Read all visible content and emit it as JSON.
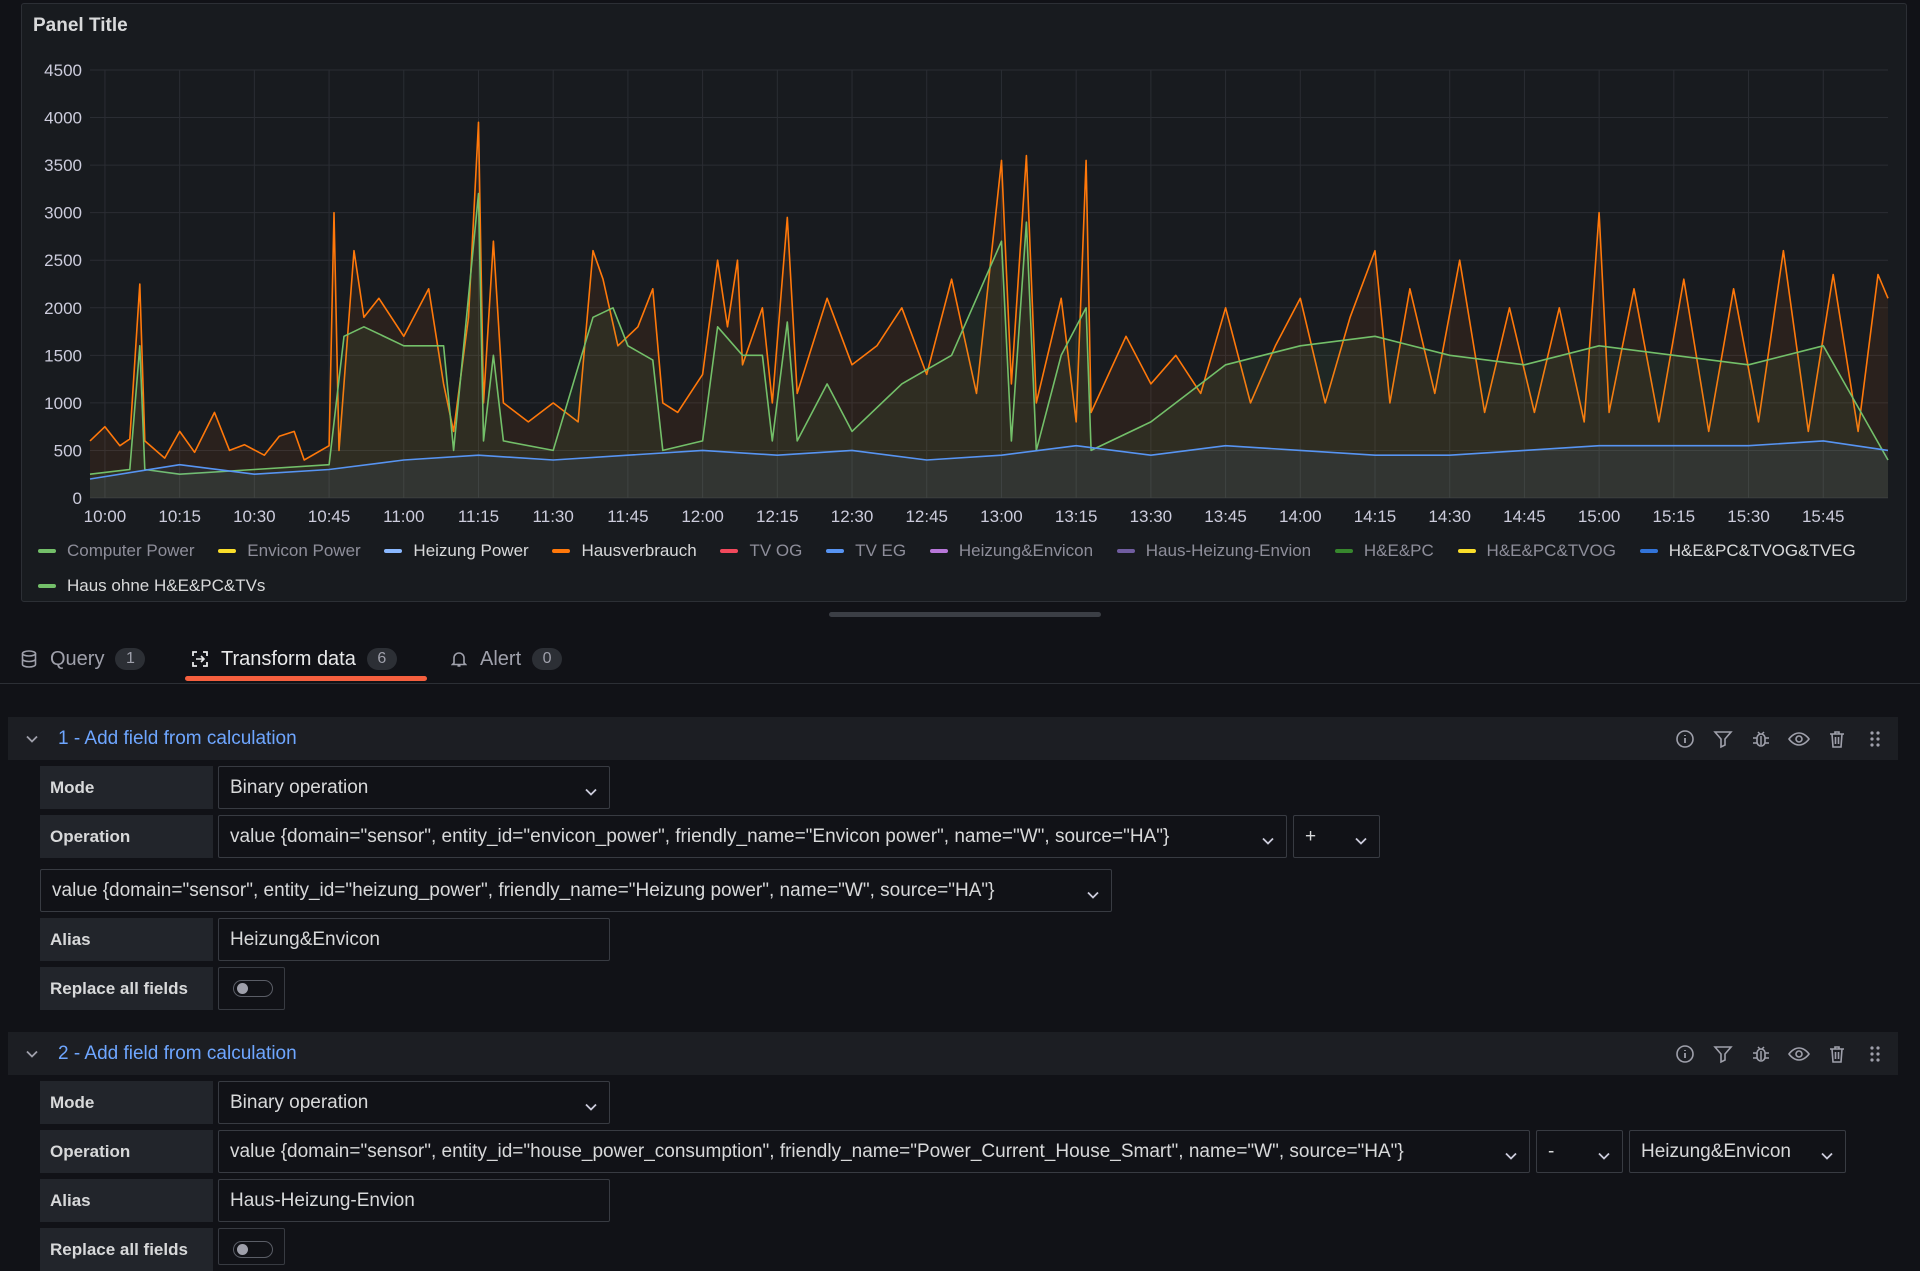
{
  "panel": {
    "title": "Panel Title"
  },
  "chart_data": {
    "type": "line",
    "title": "Panel Title",
    "y_ticks": [
      "4500",
      "4000",
      "3500",
      "3000",
      "2500",
      "2000",
      "1500",
      "1000",
      "500",
      "0"
    ],
    "x_ticks": [
      "10:00",
      "10:15",
      "10:30",
      "10:45",
      "11:00",
      "11:15",
      "11:30",
      "11:45",
      "12:00",
      "12:15",
      "12:30",
      "12:45",
      "13:00",
      "13:15",
      "13:30",
      "13:45",
      "14:00",
      "14:15",
      "14:30",
      "14:45",
      "15:00",
      "15:15",
      "15:30",
      "15:45"
    ],
    "ylim": [
      0,
      4500
    ],
    "x_range": [
      "09:57",
      "15:58"
    ],
    "grid": true,
    "legend_position": "bottom",
    "series": [
      {
        "name": "Hausverbrauch",
        "color": "#ff780a",
        "points": [
          [
            "09:57",
            600
          ],
          [
            "10:00",
            750
          ],
          [
            "10:03",
            550
          ],
          [
            "10:05",
            620
          ],
          [
            "10:07",
            2250
          ],
          [
            "10:08",
            600
          ],
          [
            "10:12",
            420
          ],
          [
            "10:15",
            700
          ],
          [
            "10:18",
            480
          ],
          [
            "10:22",
            900
          ],
          [
            "10:25",
            500
          ],
          [
            "10:28",
            560
          ],
          [
            "10:32",
            450
          ],
          [
            "10:35",
            650
          ],
          [
            "10:38",
            700
          ],
          [
            "10:40",
            400
          ],
          [
            "10:45",
            550
          ],
          [
            "10:46",
            3000
          ],
          [
            "10:47",
            500
          ],
          [
            "10:50",
            2600
          ],
          [
            "10:52",
            1900
          ],
          [
            "10:55",
            2100
          ],
          [
            "11:00",
            1700
          ],
          [
            "11:05",
            2200
          ],
          [
            "11:08",
            1200
          ],
          [
            "11:10",
            700
          ],
          [
            "11:13",
            1900
          ],
          [
            "11:15",
            3950
          ],
          [
            "11:16",
            1000
          ],
          [
            "11:18",
            2700
          ],
          [
            "11:20",
            1000
          ],
          [
            "11:25",
            800
          ],
          [
            "11:30",
            1000
          ],
          [
            "11:35",
            800
          ],
          [
            "11:38",
            2600
          ],
          [
            "11:40",
            2300
          ],
          [
            "11:43",
            1600
          ],
          [
            "11:47",
            1800
          ],
          [
            "11:50",
            2200
          ],
          [
            "11:52",
            1000
          ],
          [
            "11:55",
            900
          ],
          [
            "12:00",
            1300
          ],
          [
            "12:03",
            2500
          ],
          [
            "12:05",
            1800
          ],
          [
            "12:07",
            2500
          ],
          [
            "12:08",
            1400
          ],
          [
            "12:12",
            2000
          ],
          [
            "12:14",
            1000
          ],
          [
            "12:17",
            2950
          ],
          [
            "12:19",
            1100
          ],
          [
            "12:25",
            2100
          ],
          [
            "12:30",
            1400
          ],
          [
            "12:35",
            1600
          ],
          [
            "12:40",
            2000
          ],
          [
            "12:45",
            1300
          ],
          [
            "12:50",
            2300
          ],
          [
            "12:55",
            1100
          ],
          [
            "13:00",
            3550
          ],
          [
            "13:02",
            1200
          ],
          [
            "13:05",
            3600
          ],
          [
            "13:07",
            1000
          ],
          [
            "13:12",
            2100
          ],
          [
            "13:15",
            800
          ],
          [
            "13:17",
            3550
          ],
          [
            "13:18",
            900
          ],
          [
            "13:25",
            1700
          ],
          [
            "13:30",
            1200
          ],
          [
            "13:35",
            1500
          ],
          [
            "13:40",
            1100
          ],
          [
            "13:45",
            2000
          ],
          [
            "13:50",
            1000
          ],
          [
            "13:55",
            1600
          ],
          [
            "14:00",
            2100
          ],
          [
            "14:05",
            1000
          ],
          [
            "14:10",
            1900
          ],
          [
            "14:15",
            2600
          ],
          [
            "14:18",
            1000
          ],
          [
            "14:22",
            2200
          ],
          [
            "14:27",
            1100
          ],
          [
            "14:32",
            2500
          ],
          [
            "14:37",
            900
          ],
          [
            "14:42",
            2000
          ],
          [
            "14:47",
            900
          ],
          [
            "14:52",
            2000
          ],
          [
            "14:57",
            800
          ],
          [
            "15:00",
            3000
          ],
          [
            "15:02",
            900
          ],
          [
            "15:07",
            2200
          ],
          [
            "15:12",
            800
          ],
          [
            "15:17",
            2300
          ],
          [
            "15:22",
            700
          ],
          [
            "15:27",
            2200
          ],
          [
            "15:32",
            800
          ],
          [
            "15:37",
            2600
          ],
          [
            "15:42",
            700
          ],
          [
            "15:47",
            2350
          ],
          [
            "15:52",
            700
          ],
          [
            "15:56",
            2350
          ],
          [
            "15:58",
            2100
          ]
        ]
      },
      {
        "name": "Haus ohne H&E&PC&TVs",
        "color": "#73bf69",
        "points": [
          [
            "09:57",
            250
          ],
          [
            "10:05",
            300
          ],
          [
            "10:07",
            1600
          ],
          [
            "10:08",
            300
          ],
          [
            "10:15",
            250
          ],
          [
            "10:30",
            300
          ],
          [
            "10:45",
            350
          ],
          [
            "10:48",
            1700
          ],
          [
            "10:52",
            1800
          ],
          [
            "11:00",
            1600
          ],
          [
            "11:08",
            1600
          ],
          [
            "11:10",
            500
          ],
          [
            "11:15",
            3200
          ],
          [
            "11:16",
            600
          ],
          [
            "11:18",
            1500
          ],
          [
            "11:20",
            600
          ],
          [
            "11:30",
            500
          ],
          [
            "11:38",
            1900
          ],
          [
            "11:42",
            2000
          ],
          [
            "11:45",
            1600
          ],
          [
            "11:50",
            1450
          ],
          [
            "11:52",
            500
          ],
          [
            "12:00",
            600
          ],
          [
            "12:03",
            1800
          ],
          [
            "12:08",
            1500
          ],
          [
            "12:12",
            1500
          ],
          [
            "12:14",
            600
          ],
          [
            "12:17",
            1850
          ],
          [
            "12:19",
            600
          ],
          [
            "12:25",
            1200
          ],
          [
            "12:30",
            700
          ],
          [
            "12:40",
            1200
          ],
          [
            "12:50",
            1500
          ],
          [
            "13:00",
            2700
          ],
          [
            "13:02",
            600
          ],
          [
            "13:05",
            2900
          ],
          [
            "13:07",
            500
          ],
          [
            "13:12",
            1500
          ],
          [
            "13:17",
            2000
          ],
          [
            "13:18",
            500
          ],
          [
            "13:30",
            800
          ],
          [
            "13:45",
            1400
          ],
          [
            "14:00",
            1600
          ],
          [
            "14:15",
            1700
          ],
          [
            "14:30",
            1500
          ],
          [
            "14:45",
            1400
          ],
          [
            "15:00",
            1600
          ],
          [
            "15:15",
            1500
          ],
          [
            "15:30",
            1400
          ],
          [
            "15:45",
            1600
          ],
          [
            "15:58",
            400
          ]
        ]
      },
      {
        "name": "H&E&PC&TVOG&TVEG",
        "color": "#5794f2",
        "points": [
          [
            "09:57",
            200
          ],
          [
            "10:15",
            350
          ],
          [
            "10:30",
            250
          ],
          [
            "10:45",
            300
          ],
          [
            "11:00",
            400
          ],
          [
            "11:15",
            450
          ],
          [
            "11:30",
            400
          ],
          [
            "11:45",
            450
          ],
          [
            "12:00",
            500
          ],
          [
            "12:15",
            450
          ],
          [
            "12:30",
            500
          ],
          [
            "12:45",
            400
          ],
          [
            "13:00",
            450
          ],
          [
            "13:15",
            550
          ],
          [
            "13:30",
            450
          ],
          [
            "13:45",
            550
          ],
          [
            "14:00",
            500
          ],
          [
            "14:15",
            450
          ],
          [
            "14:30",
            450
          ],
          [
            "14:45",
            500
          ],
          [
            "15:00",
            550
          ],
          [
            "15:15",
            550
          ],
          [
            "15:30",
            550
          ],
          [
            "15:45",
            600
          ],
          [
            "15:58",
            500
          ]
        ]
      }
    ]
  },
  "legend": [
    {
      "label": "Computer Power",
      "color": "#73bf69",
      "active": false
    },
    {
      "label": "Envicon Power",
      "color": "#fade2a",
      "active": false
    },
    {
      "label": "Heizung Power",
      "color": "#8ab8ff",
      "active": true
    },
    {
      "label": "Hausverbrauch",
      "color": "#ff780a",
      "active": true
    },
    {
      "label": "TV OG",
      "color": "#f2495c",
      "active": false
    },
    {
      "label": "TV EG",
      "color": "#5794f2",
      "active": false
    },
    {
      "label": "Heizung&Envicon",
      "color": "#b877d9",
      "active": false
    },
    {
      "label": "Haus-Heizung-Envion",
      "color": "#705da0",
      "active": false
    },
    {
      "label": "H&E&PC",
      "color": "#37872d",
      "active": false
    },
    {
      "label": "H&E&PC&TVOG",
      "color": "#fade2a",
      "active": false
    },
    {
      "label": "H&E&PC&TVOG&TVEG",
      "color": "#3274d9",
      "active": true
    },
    {
      "label": "Haus ohne H&E&PC&TVs",
      "color": "#73bf69",
      "active": true
    }
  ],
  "tabs": {
    "query": {
      "label": "Query",
      "count": "1"
    },
    "transform": {
      "label": "Transform data",
      "count": "6"
    },
    "alert": {
      "label": "Alert",
      "count": "0"
    }
  },
  "transforms": [
    {
      "title": "1 - Add field from calculation",
      "mode_label": "Mode",
      "mode_value": "Binary operation",
      "operation_label": "Operation",
      "left": "value {domain=\"sensor\", entity_id=\"envicon_power\", friendly_name=\"Envicon power\", name=\"W\", source=\"HA\"}",
      "operator": "+",
      "right": "value {domain=\"sensor\", entity_id=\"heizung_power\", friendly_name=\"Heizung power\", name=\"W\", source=\"HA\"}",
      "alias_label": "Alias",
      "alias": "Heizung&Envicon",
      "replace_label": "Replace all fields",
      "replace_all": false
    },
    {
      "title": "2 - Add field from calculation",
      "mode_label": "Mode",
      "mode_value": "Binary operation",
      "operation_label": "Operation",
      "left": "value {domain=\"sensor\", entity_id=\"house_power_consumption\", friendly_name=\"Power_Current_House_Smart\", name=\"W\", source=\"HA\"}",
      "operator": "-",
      "right": "Heizung&Envicon",
      "alias_label": "Alias",
      "alias": "Haus-Heizung-Envion",
      "replace_label": "Replace all fields",
      "replace_all": false
    }
  ]
}
